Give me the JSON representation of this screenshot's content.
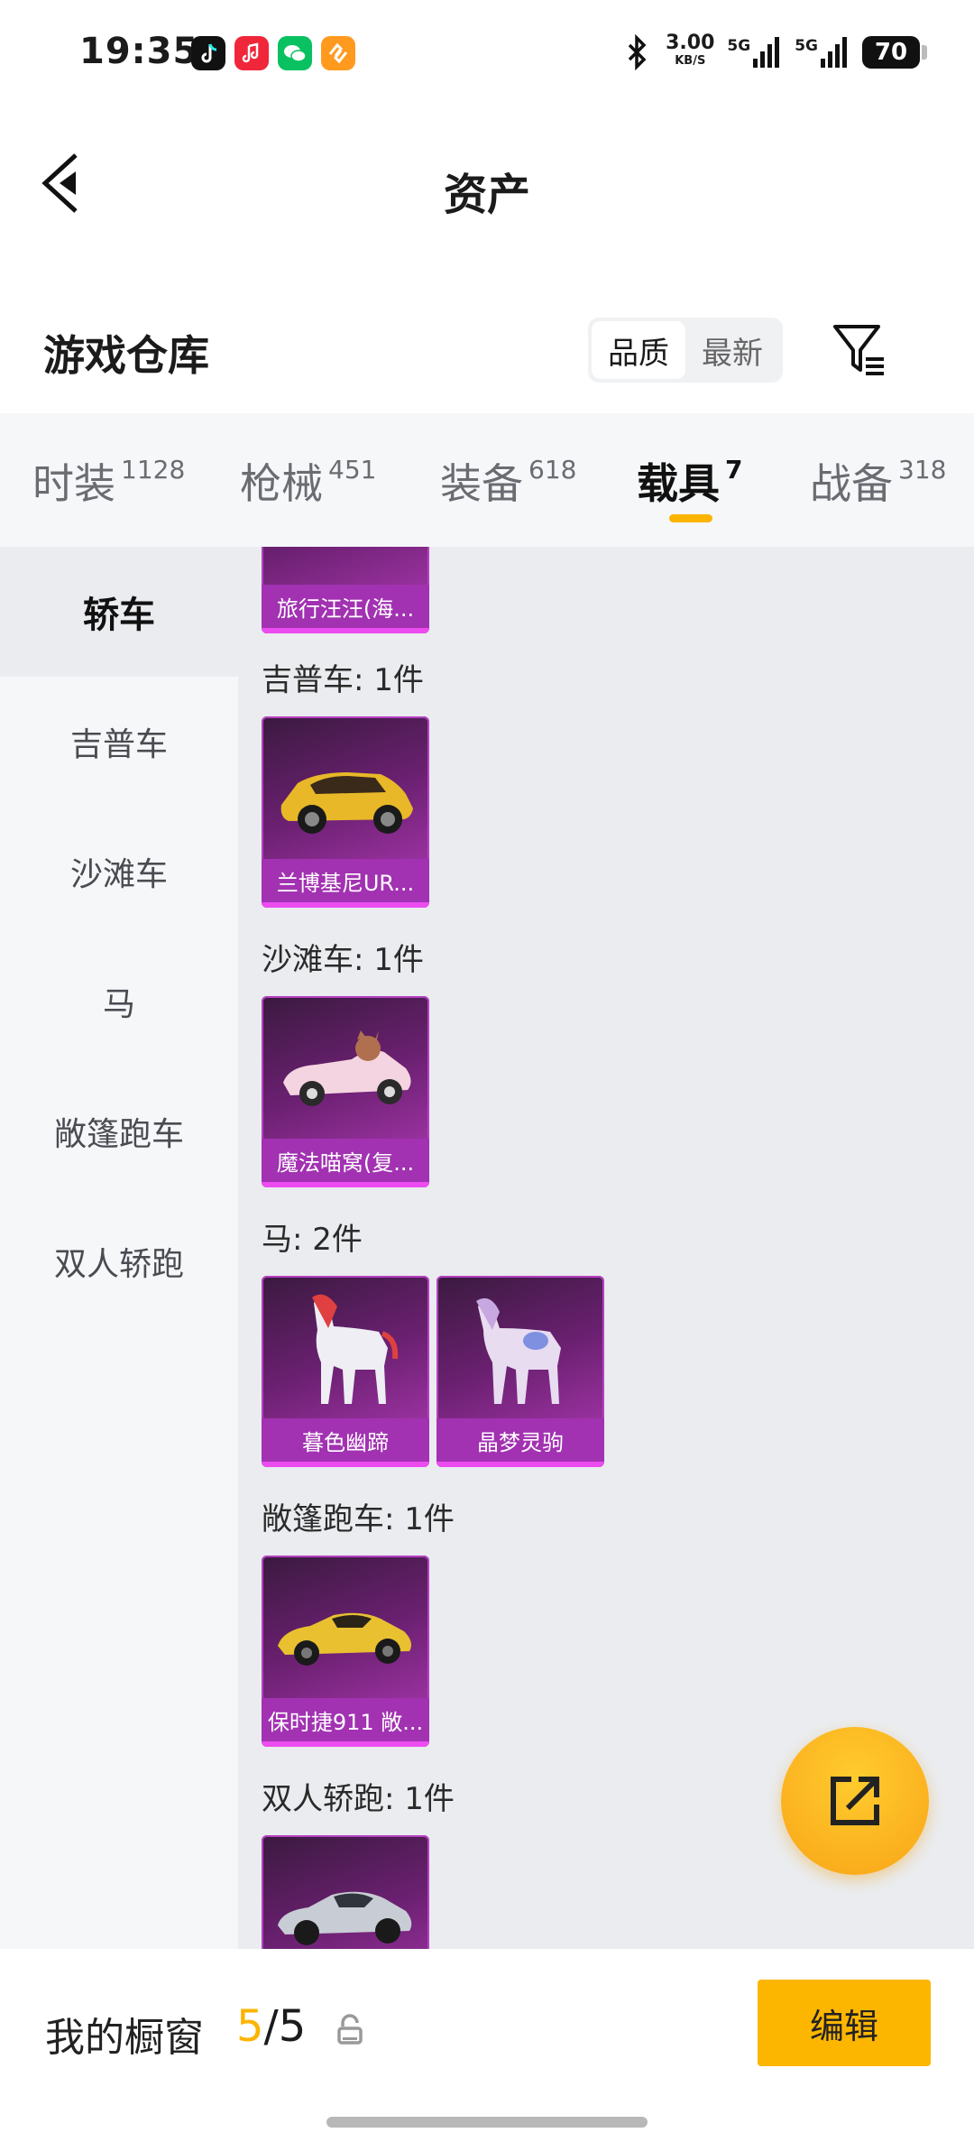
{
  "status": {
    "time": "19:35",
    "net_speed": "3.00",
    "net_unit": "KB/S",
    "net_type": "5G",
    "battery": "70"
  },
  "header": {
    "title": "资产"
  },
  "warehouse": {
    "title": "游戏仓库",
    "sort": [
      {
        "label": "品质",
        "active": true
      },
      {
        "label": "最新",
        "active": false
      }
    ]
  },
  "tabs": [
    {
      "label": "时装",
      "count": "1128"
    },
    {
      "label": "枪械",
      "count": "451"
    },
    {
      "label": "装备",
      "count": "618"
    },
    {
      "label": "载具",
      "count": "7",
      "active": true
    },
    {
      "label": "战备",
      "count": "318"
    }
  ],
  "sidebar": [
    "轿车",
    "吉普车",
    "沙滩车",
    "马",
    "敞篷跑车",
    "双人轿跑"
  ],
  "groups": {
    "sedan": {
      "items": [
        "旅行汪汪(海..."
      ]
    },
    "jeep": {
      "heading": "吉普车: 1件",
      "items": [
        "兰博基尼UR..."
      ]
    },
    "beach": {
      "heading": "沙滩车: 1件",
      "items": [
        "魔法喵窝(复..."
      ]
    },
    "horse": {
      "heading": "马: 2件",
      "items": [
        "暮色幽蹄",
        "晶梦灵驹"
      ]
    },
    "convertible": {
      "heading": "敞篷跑车: 1件",
      "items": [
        "保时捷911 敞..."
      ]
    },
    "coupe": {
      "heading": "双人轿跑: 1件",
      "items": [
        ""
      ]
    }
  },
  "bottom": {
    "label": "我的橱窗",
    "count_used": "5",
    "count_sep": "/",
    "count_total": "5",
    "edit_label": "编辑"
  },
  "colors": {
    "accent": "#fcb400",
    "card_purple": "#a232b2"
  }
}
